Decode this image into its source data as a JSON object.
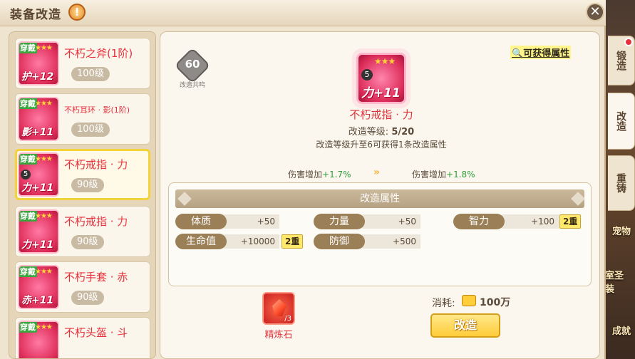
{
  "window": {
    "title": "装备改造",
    "help_icon": "!",
    "close_icon": "✕"
  },
  "side_tabs": [
    {
      "label": "锻造",
      "badge": true
    },
    {
      "label": "改造",
      "active": true
    },
    {
      "label": "重铸"
    }
  ],
  "background_labels": [
    "宠物",
    "室圣装",
    "成就"
  ],
  "equipment_list": [
    {
      "tag": "穿戴",
      "stars": "★★★",
      "enhance": "+12",
      "slot": "护",
      "name": "不朽之斧(1阶)",
      "level": "100级"
    },
    {
      "tag": "穿戴",
      "stars": "★★★",
      "enhance": "+11",
      "slot": "影",
      "name": "不朽耳环 · 影(1阶)",
      "level": "100级"
    },
    {
      "tag": "穿戴",
      "stars": "★★★",
      "enhance": "+11",
      "slot": "力",
      "refine": "5",
      "name": "不朽戒指 · 力",
      "level": "90级",
      "selected": true
    },
    {
      "tag": "穿戴",
      "stars": "★★★",
      "enhance": "+11",
      "slot": "力",
      "name": "不朽戒指 · 力",
      "level": "90级"
    },
    {
      "tag": "穿戴",
      "stars": "★★★",
      "enhance": "+11",
      "slot": "赤",
      "name": "不朽手套 · 赤",
      "level": "90级"
    },
    {
      "tag": "穿戴",
      "stars": "★★★",
      "enhance": "",
      "slot": "",
      "name": "不朽头盔 · 斗",
      "level": ""
    }
  ],
  "badge": {
    "value": "60",
    "caption": "改造共鸣"
  },
  "detail": {
    "icon_stars": "★★★",
    "icon_refine": "5",
    "icon_enhance": "力+11",
    "name": "不朽戒指 · 力",
    "refine_label": "改造等级:",
    "refine_value": "5/20",
    "hint": "改造等级升至6可获得1条改造属性",
    "attr_link": "可获得属性",
    "damage_left_label": "伤害增加",
    "damage_left_value": "+1.7%",
    "damage_right_label": "伤害增加",
    "damage_right_value": "+1.8%",
    "arrows": "»"
  },
  "attributes": {
    "header": "改造属性",
    "stats": [
      {
        "label": "体质",
        "value": "+50"
      },
      {
        "label": "力量",
        "value": "+50"
      },
      {
        "label": "智力",
        "value": "+100",
        "chip": "2重"
      },
      {
        "label": "生命值",
        "value": "+10000",
        "chip": "2重"
      },
      {
        "label": "防御",
        "value": "+500"
      }
    ]
  },
  "material": {
    "count": "/3",
    "name": "精炼石"
  },
  "cost": {
    "label": "消耗:",
    "value": "100万"
  },
  "action": {
    "label": "改造"
  }
}
